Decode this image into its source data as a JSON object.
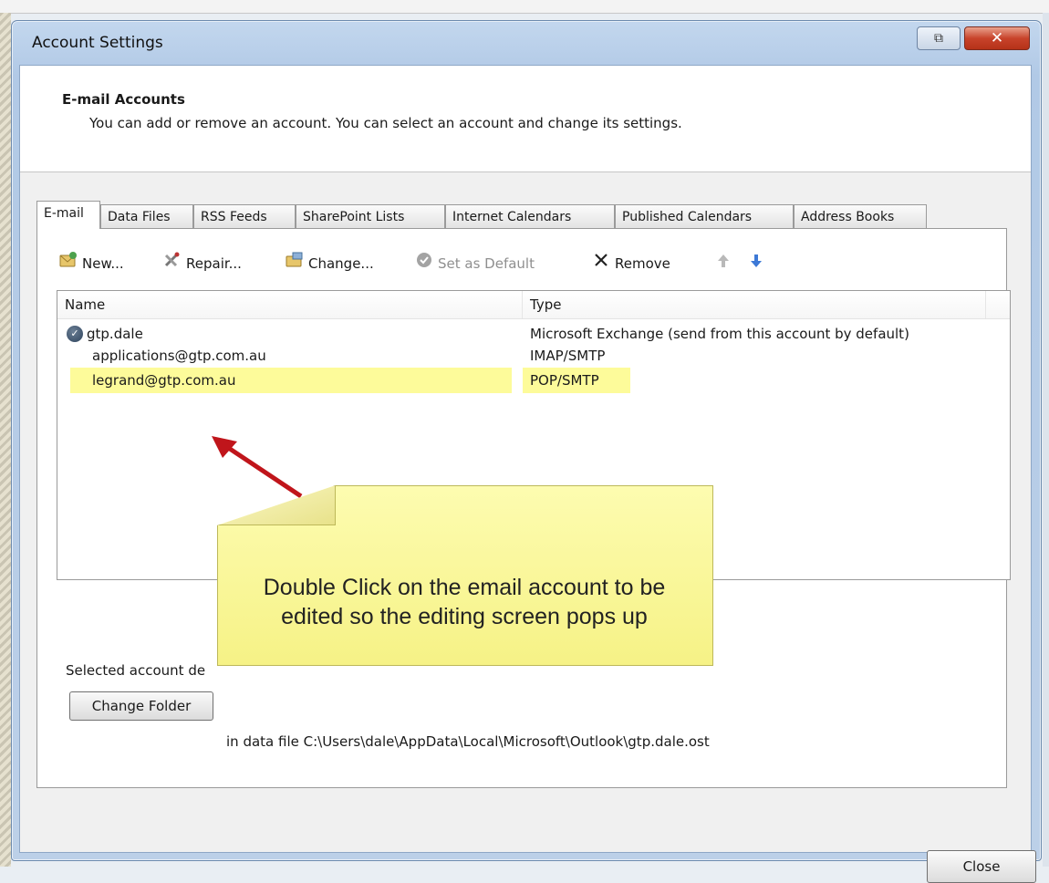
{
  "window": {
    "title": "Account Settings",
    "restore_glyph": "⧉",
    "close_glyph": "✕"
  },
  "header": {
    "title": "E-mail Accounts",
    "description": "You can add or remove an account. You can select an account and change its settings."
  },
  "tabs": [
    {
      "label": "E-mail",
      "active": true
    },
    {
      "label": "Data Files"
    },
    {
      "label": "RSS Feeds"
    },
    {
      "label": "SharePoint Lists"
    },
    {
      "label": "Internet Calendars"
    },
    {
      "label": "Published Calendars"
    },
    {
      "label": "Address Books"
    }
  ],
  "toolbar": {
    "new_label": "New...",
    "repair_label": "Repair...",
    "change_label": "Change...",
    "set_default_label": "Set as Default",
    "remove_label": "Remove",
    "icons": [
      "new-mail-icon",
      "repair-tools-icon",
      "change-icon",
      "check-icon",
      "remove-x-icon",
      "move-up-icon",
      "move-down-icon"
    ]
  },
  "accounts_table": {
    "columns": [
      "Name",
      "Type"
    ],
    "rows": [
      {
        "name": "gtp.dale",
        "type": "Microsoft Exchange (send from this account by default)",
        "default": true
      },
      {
        "name": "applications@gtp.com.au",
        "type": "IMAP/SMTP"
      },
      {
        "name": "legrand@gtp.com.au",
        "type": "POP/SMTP",
        "highlighted": true
      }
    ]
  },
  "selected_account": {
    "label": "Selected account de",
    "change_folder_label": "Change Folder",
    "data_file_text": "in data file C:\\Users\\dale\\AppData\\Local\\Microsoft\\Outlook\\gtp.dale.ost"
  },
  "footer": {
    "close_label": "Close"
  },
  "annotation": {
    "text_line1": "Double Click on the email account to be",
    "text_line2": "edited so the editing screen pops up",
    "highlight_color": "#fdfb9a",
    "arrow_color": "#c0151b"
  }
}
